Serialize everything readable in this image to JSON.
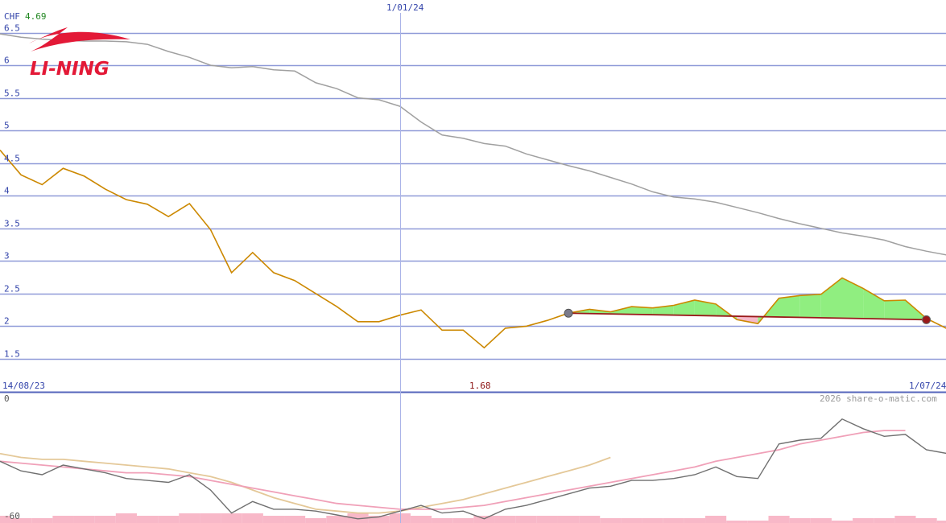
{
  "header": {
    "currency": "CHF",
    "last_value": "4.69",
    "watermark": "2026 share-o-matic.com"
  },
  "brand": {
    "logo_text": "LI-NING",
    "logo_color": "#e31937"
  },
  "colors": {
    "grid": "#8f9ad8",
    "axis_text": "#3344aa",
    "price": "#cc8800",
    "sma_long": "#a0a0a0",
    "trend": "#9a1a1a",
    "gain_fill": "#90ee80",
    "loss_fill": "#f6b8c8",
    "osc_line": "#707070",
    "osc_pink": "#f0a0b8",
    "osc_tan": "#e4c898",
    "volume": "#f8b8c8",
    "currency_text": "#228822",
    "min_text": "#8b1010"
  },
  "chart_data": [
    {
      "type": "line",
      "name": "price-panel",
      "x_labels": {
        "start": "14/08/23",
        "marker": "1/01/24",
        "end": "1/07/24"
      },
      "y_ticks": [
        "1.5",
        "2",
        "2.5",
        "3",
        "3.5",
        "4",
        "4.5",
        "5",
        "5.5",
        "6",
        "6.5"
      ],
      "ylim": [
        1.5,
        6.5
      ],
      "min_label": "1.68",
      "series": [
        {
          "role": "price",
          "values": [
            4.7,
            4.32,
            4.17,
            4.42,
            4.3,
            4.1,
            3.94,
            3.87,
            3.68,
            3.88,
            3.48,
            2.82,
            3.13,
            2.82,
            2.7,
            2.5,
            2.3,
            2.07,
            2.07,
            2.17,
            2.25,
            1.94,
            1.94,
            1.67,
            1.97,
            2.0,
            2.09,
            2.2,
            2.26,
            2.22,
            2.3,
            2.28,
            2.32,
            2.4,
            2.34,
            2.1,
            2.04,
            2.43,
            2.47,
            2.49,
            2.74,
            2.58,
            2.39,
            2.4,
            2.12,
            1.96
          ]
        },
        {
          "role": "moving-average",
          "values": [
            6.48,
            6.43,
            6.4,
            6.38,
            6.37,
            6.37,
            6.36,
            6.32,
            6.21,
            6.12,
            6.0,
            5.96,
            5.98,
            5.93,
            5.91,
            5.73,
            5.64,
            5.5,
            5.47,
            5.37,
            5.13,
            4.93,
            4.88,
            4.8,
            4.76,
            4.64,
            4.55,
            4.46,
            4.38,
            4.28,
            4.18,
            4.06,
            3.98,
            3.95,
            3.9,
            3.82,
            3.74,
            3.65,
            3.57,
            3.5,
            3.43,
            3.38,
            3.32,
            3.22,
            3.15,
            3.09,
            3.04
          ]
        }
      ],
      "trend": {
        "from": [
          27,
          2.2
        ],
        "to": [
          44,
          2.1
        ]
      }
    },
    {
      "type": "line",
      "name": "oscillator-panel",
      "y_ticks": [
        "0",
        "-60"
      ],
      "ylim": [
        -60,
        0
      ],
      "series": [
        {
          "role": "oscillator",
          "values": [
            -32,
            -37,
            -39,
            -34,
            -36,
            -38,
            -41,
            -42,
            -43,
            -39,
            -47,
            -59,
            -53,
            -57,
            -57,
            -58,
            -60,
            -62,
            -61,
            -58,
            -55,
            -59,
            -58,
            -62,
            -57,
            -55,
            -52,
            -49,
            -46,
            -45,
            -42,
            -42,
            -41,
            -39,
            -35,
            -40,
            -41,
            -23,
            -21,
            -20,
            -10,
            -15,
            -19,
            -18,
            -26,
            -28
          ]
        },
        {
          "role": "average-fast",
          "values": [
            -32,
            -33,
            -34,
            -35,
            -36,
            -37,
            -38,
            -38,
            -39,
            -40,
            -42,
            -44,
            -46,
            -48,
            -50,
            -52,
            -54,
            -55,
            -56,
            -57,
            -57,
            -57,
            -56,
            -55,
            -53,
            -51,
            -49,
            -47,
            -45,
            -43,
            -41,
            -39,
            -37,
            -35,
            -32,
            -30,
            -28,
            -26,
            -23,
            -21,
            -19,
            -17,
            -16,
            -16
          ]
        },
        {
          "role": "average-slow",
          "values": [
            -28,
            -30,
            -31,
            -31,
            -32,
            -33,
            -34,
            -35,
            -36,
            -38,
            -40,
            -43,
            -47,
            -51,
            -54,
            -57,
            -58,
            -59,
            -59,
            -58,
            -56,
            -54,
            -52,
            -49,
            -46,
            -43,
            -40,
            -37,
            -34,
            -30
          ]
        },
        {
          "role": "volume",
          "values": [
            3,
            2,
            2,
            3,
            3,
            3,
            4,
            3,
            3,
            4,
            4,
            4,
            4,
            3,
            3,
            2,
            3,
            4,
            3,
            4,
            3,
            2,
            2,
            3,
            3,
            3,
            3,
            3,
            3,
            2,
            2,
            2,
            2,
            2,
            3,
            1,
            1,
            3,
            2,
            2,
            1,
            2,
            2,
            3,
            2,
            1
          ]
        }
      ]
    }
  ]
}
